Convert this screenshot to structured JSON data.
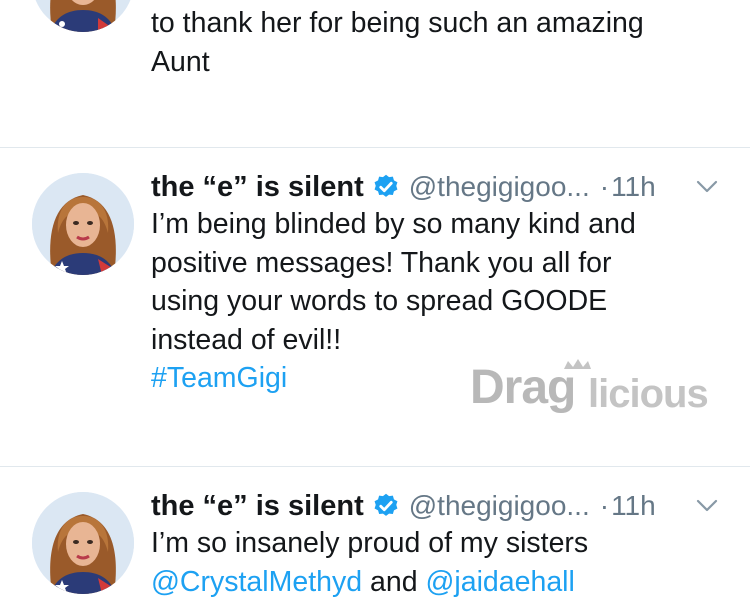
{
  "tweet0": {
    "lines": [
      "to thank her for being such an amazing",
      "Aunt"
    ]
  },
  "tweet1": {
    "display_name": "the “e” is silent",
    "handle": "@thegigigoo...",
    "dot": "·",
    "time": "11h",
    "lines": [
      "I’m being blinded by so many kind and",
      "positive messages! Thank you all for",
      "using your words to spread GOODE",
      "instead of evil!!"
    ],
    "hashtag": "#TeamGigi"
  },
  "tweet2": {
    "display_name": "the “e” is silent",
    "handle": "@thegigigoo...",
    "dot": "·",
    "time": "11h",
    "line1": "I’m so insanely proud of my sisters",
    "mention1": "@CrystalMethyd",
    "and_text": " and ",
    "mention2": "@jaidaehall"
  },
  "watermark": {
    "text": "Draglicious"
  },
  "icons": {
    "verified": "verified-badge-icon",
    "chevron": "chevron-down-icon",
    "avatar": "avatar"
  },
  "colors": {
    "link": "#1da1f2",
    "verified": "#1da1f2",
    "secondary_text": "#657786",
    "divider": "#e1e8ed",
    "watermark": "#b8b8b8"
  }
}
